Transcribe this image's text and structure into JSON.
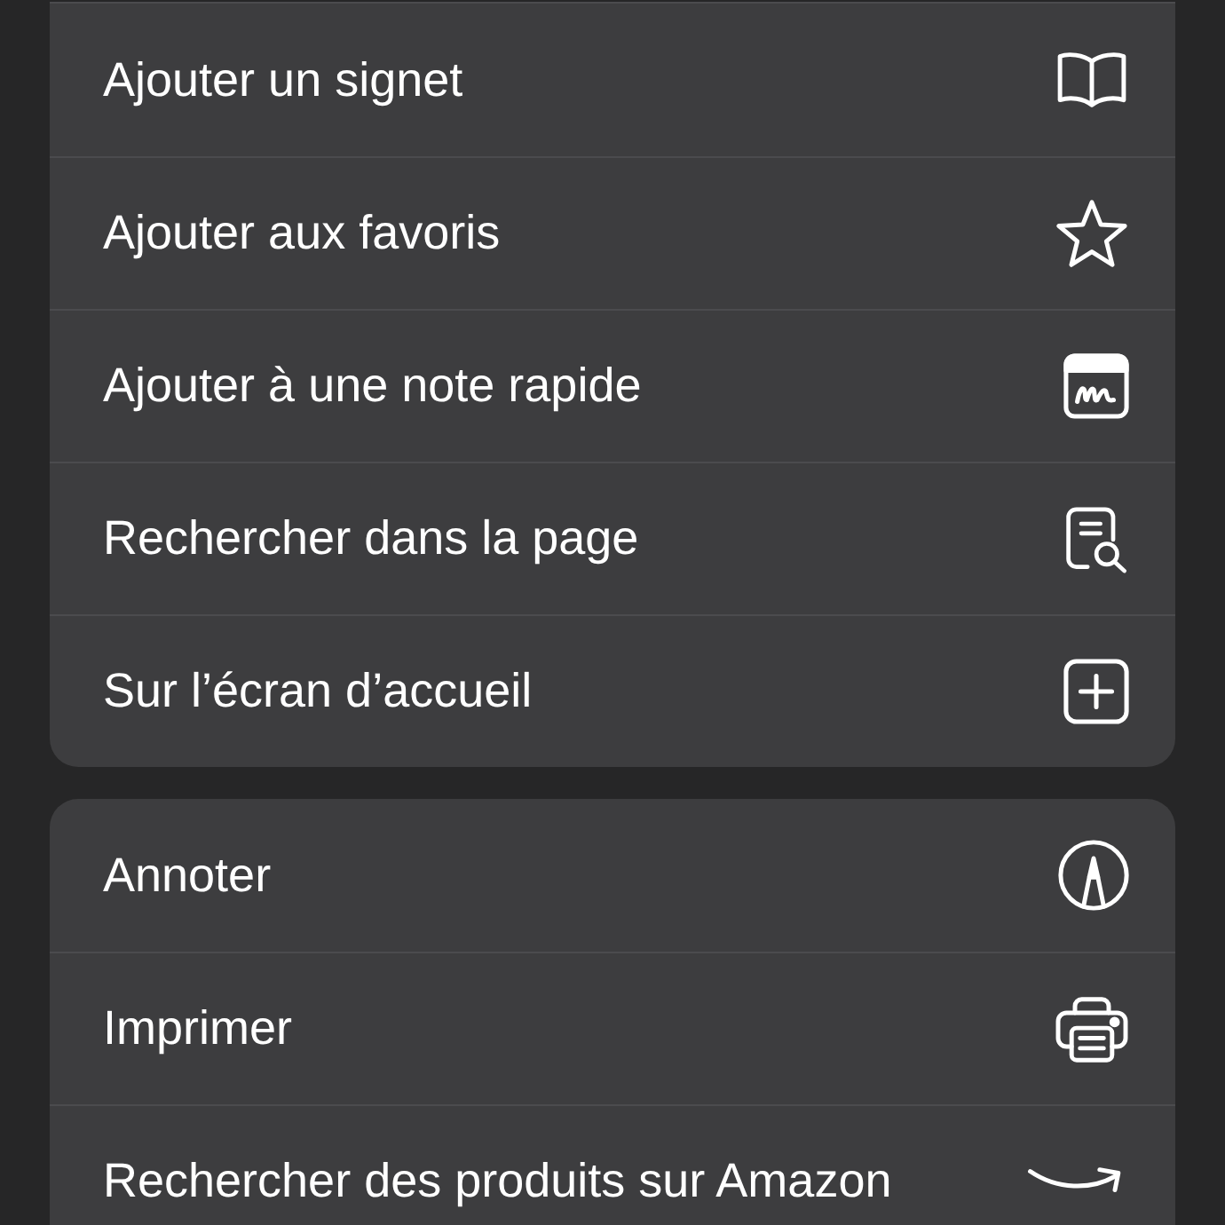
{
  "menu_groups": [
    {
      "items": [
        {
          "label": "Ajouter un signet"
        },
        {
          "label": "Ajouter aux favoris"
        },
        {
          "label": "Ajouter à une note rapide"
        },
        {
          "label": "Rechercher dans la page"
        },
        {
          "label": "Sur l’écran d’accueil"
        }
      ]
    },
    {
      "items": [
        {
          "label": "Annoter"
        },
        {
          "label": "Imprimer"
        },
        {
          "label": "Rechercher des produits sur Amazon"
        }
      ]
    }
  ]
}
